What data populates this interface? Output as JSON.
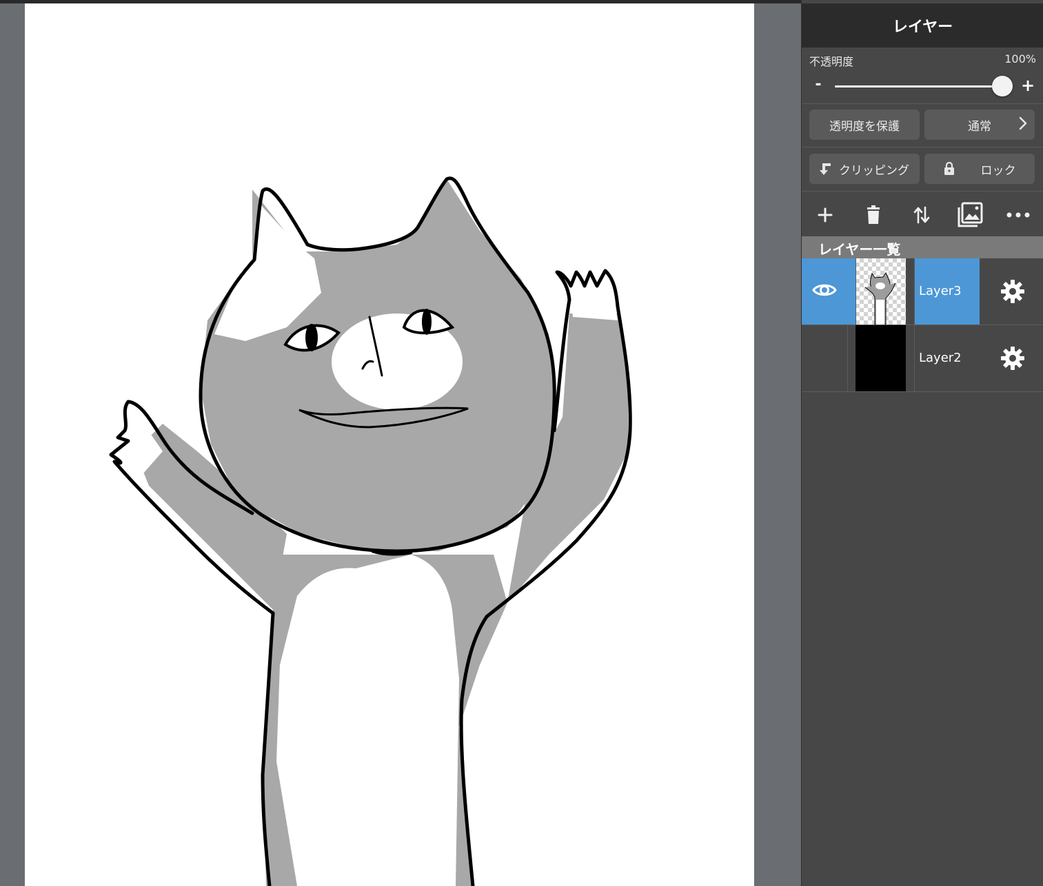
{
  "panel": {
    "title": "レイヤー",
    "opacity": {
      "label": "不透明度",
      "value_text": "100%",
      "value": 1.0,
      "minus": "-",
      "plus": "+"
    },
    "protect_alpha_label": "透明度を保護",
    "blend_mode_label": "通常",
    "clipping_label": "クリッピング",
    "lock_label": "ロック",
    "tools": [
      "plus-icon",
      "trash-icon",
      "move-layer-icon",
      "image-icon",
      "more-icon"
    ],
    "list_title": "レイヤー一覧",
    "layers": [
      {
        "name": "Layer3",
        "selected": true,
        "visible": true
      },
      {
        "name": "Layer2",
        "selected": false,
        "visible": false
      }
    ]
  },
  "colors": {
    "accent": "#4d97d6",
    "panel_bg": "#474747",
    "header_bg": "#2b2b2b",
    "button_bg": "#5a5a5a",
    "canvas_bg": "#6a6d71",
    "cat_gray": "#a8a8a8"
  }
}
